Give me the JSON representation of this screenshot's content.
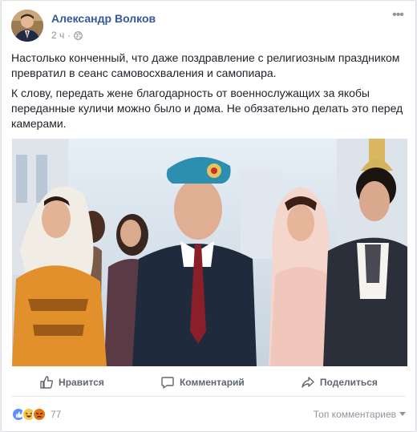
{
  "post": {
    "author": "Александр Волков",
    "time": "2 ч",
    "paragraphs": [
      "Настолько конченный, что даже поздравление с религиозным праздником превратил в сеанс самовосхваления и самопиара.",
      "К слову, передать жене благодарность от военнослужащих за якобы переданные куличи можно было и дома. Не обязательно делать это перед камерами."
    ]
  },
  "actions": {
    "like": "Нравится",
    "comment": "Комментарий",
    "share": "Поделиться"
  },
  "footer": {
    "reaction_count": "77",
    "top_comments": "Топ комментариев",
    "reaction_icons": [
      "like-icon",
      "haha-icon",
      "angry-icon"
    ]
  },
  "colors": {
    "author_link": "#365899",
    "meta": "#90949c",
    "action_text": "#606770",
    "like_blue": "#5890ff",
    "angry_red": "#e9710f"
  }
}
